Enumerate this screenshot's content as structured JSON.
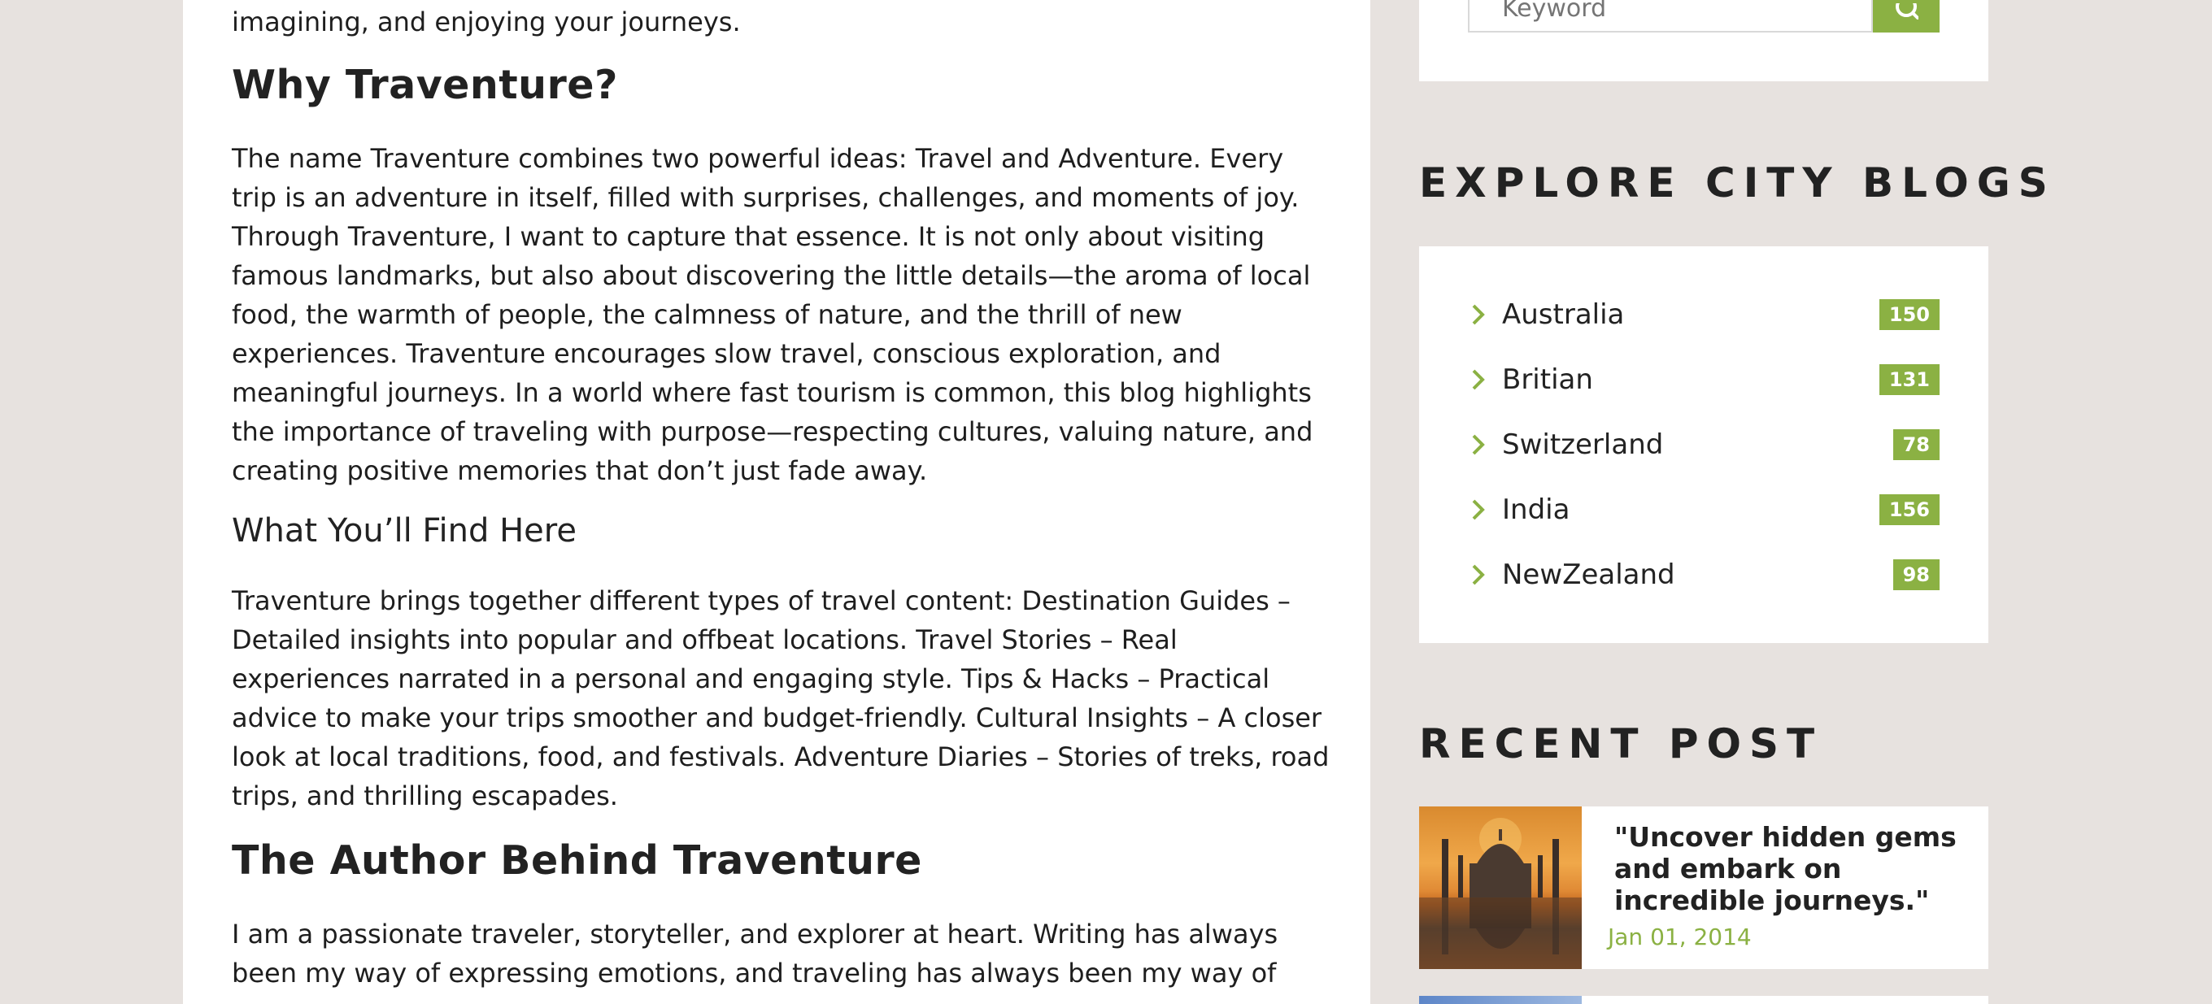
{
  "article": {
    "intro_tail": "imagining, and enjoying your journeys.",
    "why_heading": "Why Traventure?",
    "why_body": "The name Traventure combines two powerful ideas: Travel and Adventure. Every trip is an adventure in itself, filled with surprises, challenges, and moments of joy. Through Traventure, I want to capture that essence. It is not only about visiting famous landmarks, but also about discovering the little details—the aroma of local food, the warmth of people, the calmness of nature, and the thrill of new experiences. Traventure encourages slow travel, conscious exploration, and meaningful journeys. In a world where fast tourism is common, this blog highlights the importance of traveling with purpose—respecting cultures, valuing nature, and creating positive memories that don’t just fade away.",
    "find_heading": "What You’ll Find Here",
    "find_body": "Traventure brings together different types of travel content: Destination Guides – Detailed insights into popular and offbeat locations. Travel Stories – Real experiences narrated in a personal and engaging style. Tips & Hacks – Practical advice to make your trips smoother and budget-friendly. Cultural Insights – A closer look at local traditions, food, and festivals. Adventure Diaries – Stories of treks, road trips, and thrilling escapades.",
    "author_heading": "The Author Behind Traventure",
    "author_body": "I am a passionate traveler, storyteller, and explorer at heart. Writing has always been my way of expressing emotions, and traveling has always been my way of"
  },
  "search": {
    "placeholder": "Keyword",
    "button_icon": "search-icon"
  },
  "sidebar": {
    "explore_title": "EXPLORE CITY BLOGS",
    "cities": [
      {
        "name": "Australia",
        "count": "150"
      },
      {
        "name": "Britian",
        "count": "131"
      },
      {
        "name": "Switzerland",
        "count": "78"
      },
      {
        "name": "India",
        "count": "156"
      },
      {
        "name": "NewZealand",
        "count": "98"
      }
    ],
    "recent_title": "RECENT POST",
    "recent_posts": [
      {
        "title": "\"Uncover hidden gems and embark on incredible journeys.\"",
        "date": "Jan 01, 2014"
      }
    ]
  },
  "colors": {
    "accent": "#8bb143",
    "page_bg": "#e7e2df",
    "card_bg": "#ffffff"
  }
}
